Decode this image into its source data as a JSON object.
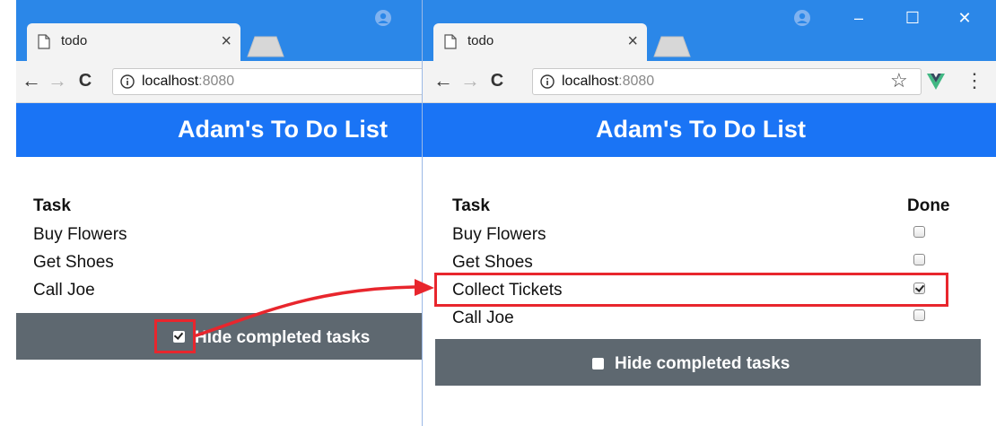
{
  "left_window": {
    "tab_title": "todo",
    "tab_close": "×",
    "url_host": "localhost",
    "url_port": ":8080",
    "app_title": "Adam's To Do List",
    "column_task": "Task",
    "tasks": [
      "Buy Flowers",
      "Get Shoes",
      "Call Joe"
    ],
    "hide_completed_label": "Hide completed tasks",
    "hide_completed_checked": true
  },
  "right_window": {
    "tab_title": "todo",
    "tab_close": "×",
    "url_host": "localhost",
    "url_port": ":8080",
    "app_title": "Adam's To Do List",
    "column_task": "Task",
    "column_done": "Done",
    "tasks": [
      {
        "label": "Buy Flowers",
        "done": false
      },
      {
        "label": "Get Shoes",
        "done": false
      },
      {
        "label": "Collect Tickets",
        "done": true
      },
      {
        "label": "Call Joe",
        "done": false
      }
    ],
    "hide_completed_label": "Hide completed tasks",
    "hide_completed_checked": false
  },
  "chrome": {
    "back": "←",
    "forward": "→",
    "reload": "C",
    "minimize": "–",
    "maximize": "☐",
    "close": "✕",
    "star": "☆",
    "menu": "⋮"
  },
  "icons": [
    "page-icon",
    "info-icon",
    "profile-icon",
    "star-icon",
    "vue-devtools-icon",
    "menu-icon",
    "checkbox-icon"
  ],
  "colors": {
    "titlebar": "#2b87e8",
    "app_header": "#1a74f5",
    "footer": "#5e6870",
    "highlight": "#e8262d"
  }
}
